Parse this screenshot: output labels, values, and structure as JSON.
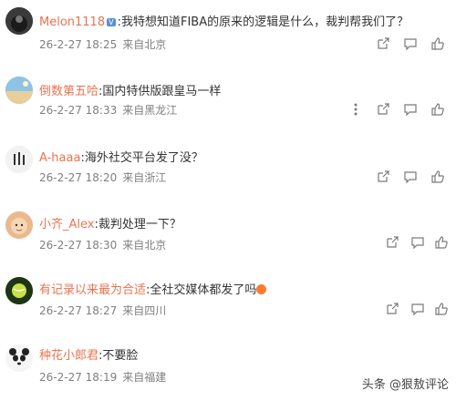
{
  "comments": [
    {
      "user": "Melon1118",
      "badge": "V",
      "text": ":我特想知道FIBA的原来的逻辑是什么，裁判帮我们了？",
      "date": "26-2-27 18:25",
      "source": "来自北京",
      "avatar_color": "#2a2a2a",
      "icons": [
        "share-icon",
        "comment-icon",
        "like-icon"
      ]
    },
    {
      "user": "倒数第五哈",
      "text": ":国内特供版跟皇马一样",
      "date": "26-2-27 18:33",
      "source": "来自黑龙江",
      "avatar_color": "#7fb6d8",
      "icons": [
        "more-icon",
        "share-icon",
        "comment-icon",
        "like-icon"
      ]
    },
    {
      "user": "A-haaa",
      "text": ":海外社交平台发了没？",
      "date": "26-2-27 18:20",
      "source": "来自浙江",
      "avatar_color": "#e8e8e8",
      "icons": [
        "share-icon",
        "comment-icon",
        "like-icon"
      ]
    },
    {
      "user": "小齐_Alex",
      "text": ":裁判处理一下？",
      "date": "26-2-27 18:30",
      "source": "来自北京",
      "avatar_color": "#f1c9a5",
      "icons": [
        "share-icon",
        "comment-icon",
        "like-icon"
      ]
    },
    {
      "user": "有记录以来最为合适",
      "text": ":全社交媒体都发了吗",
      "date": "26-2-27 18:27",
      "source": "来自四川",
      "avatar_color": "#1f3b17",
      "icons": [
        "share-icon",
        "comment-icon",
        "like-icon"
      ]
    },
    {
      "user": "种花小郎君",
      "text": ":不要脸",
      "date": "26-2-27 18:19",
      "source": "来自福建",
      "avatar_color": "#f3f3f3",
      "icons": []
    }
  ],
  "watermark": "头条 @狠敖评论",
  "colors": {
    "username": "#eb7350",
    "meta": "#808080",
    "icon": "#7a7a7a"
  }
}
